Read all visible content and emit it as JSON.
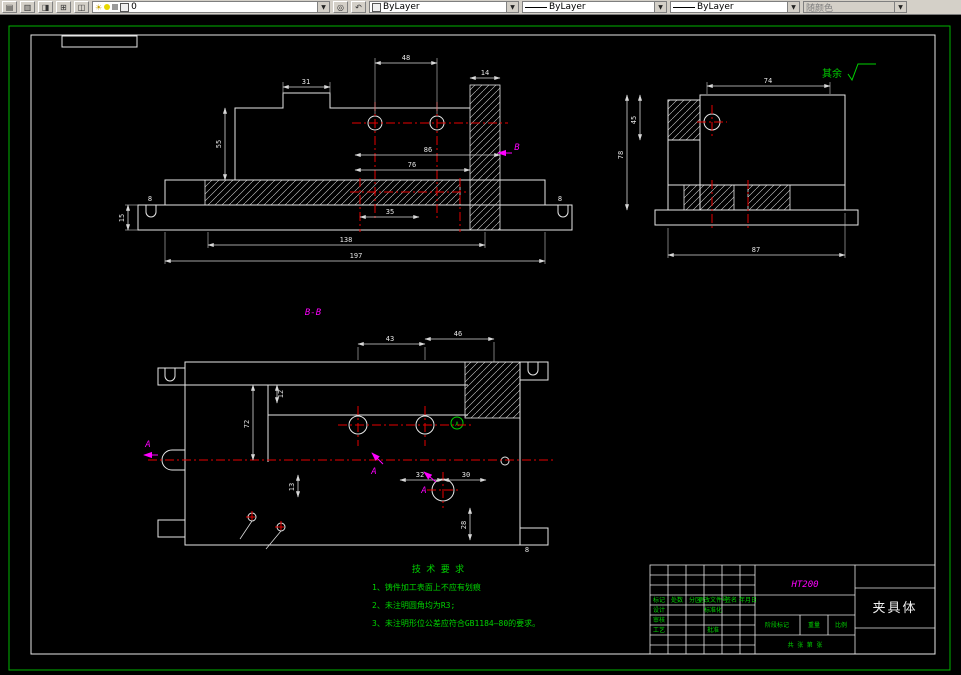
{
  "toolbar": {
    "layer": {
      "value": "0"
    },
    "color": {
      "value": "ByLayer"
    },
    "linetype": {
      "value": "ByLayer"
    },
    "lineweight": {
      "value": "ByLayer"
    },
    "plot_style": {
      "value": "随颜色"
    }
  },
  "colors": {
    "object_line": "#e6e6e6",
    "centerline": "#e60000",
    "annotation_accent": "#ff00ff",
    "note_text": "#00d200",
    "frame": "#00b400",
    "toolbar_bg": "#d4d0c8"
  },
  "annotation": {
    "surface_note": "其余"
  },
  "front_view": {
    "dims": {
      "d48": "48",
      "d31": "31",
      "d14": "14",
      "d55": "55",
      "d15": "15",
      "d86": "86",
      "d76": "76",
      "d35": "35",
      "d138": "138",
      "d197": "197",
      "d8_left": "8",
      "d8_right": "8"
    },
    "section_marker": "B"
  },
  "side_view": {
    "dims": {
      "d74": "74",
      "d87": "87",
      "d45": "45",
      "d78": "78"
    }
  },
  "section_view": {
    "label": "B-B",
    "dims": {
      "d43": "43",
      "d46": "46",
      "d72": "72",
      "d12": "12",
      "d13": "13",
      "d32": "32",
      "d30": "30",
      "d28": "28",
      "d8": "8"
    },
    "datum": "A",
    "markers": {
      "a1": "A",
      "a2": "A",
      "a3": "A"
    }
  },
  "tech_requirements": {
    "title": "技 术 要 求",
    "items": [
      "1、铸件加工表面上不应有划痕",
      "2、未注明圆角均为R3;",
      "3、未注明形位公差应符合GB1184—80的要求。"
    ]
  },
  "title_block": {
    "material": "HT200",
    "part_name": "夹具体",
    "labels": {
      "mark": "标记",
      "count": "处数",
      "zone": "分区",
      "change_no": "更改文件号",
      "sign": "签名",
      "date": "年月日",
      "design": "设计",
      "standard": "标准化",
      "check": "审核",
      "approve": "批准",
      "process": "工艺",
      "stage": "阶段标记",
      "weight": "重量",
      "scale": "比例",
      "sheets": "共 张 第 张"
    }
  }
}
